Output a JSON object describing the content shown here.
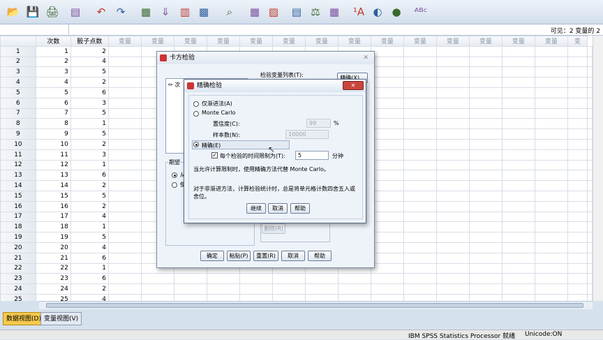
{
  "toolbar": {
    "icons": [
      "open-icon",
      "save-icon",
      "print-icon",
      "dialog-recall-icon",
      "undo-icon",
      "redo-icon",
      "goto-case-icon",
      "goto-variable-icon",
      "variables-icon",
      "run-descriptives-icon",
      "find-icon",
      "insert-cases-icon",
      "insert-variable-icon",
      "split-file-icon",
      "weight-cases-icon",
      "select-cases-icon",
      "value-labels-icon",
      "use-variable-sets-icon",
      "show-all-variables-icon",
      "spell-check-icon"
    ]
  },
  "visible_label": "可见：2 变量的 2",
  "grid": {
    "headers": [
      "次数",
      "骰子点数",
      "变量",
      "变量",
      "变量",
      "变量",
      "变量",
      "变量",
      "变量",
      "变量",
      "变量",
      "变量",
      "变量",
      "变量",
      "变量",
      "变量",
      "变"
    ],
    "rows": [
      [
        "1",
        "1",
        "2"
      ],
      [
        "2",
        "2",
        "4"
      ],
      [
        "3",
        "3",
        "5"
      ],
      [
        "4",
        "4",
        "2"
      ],
      [
        "5",
        "5",
        "6"
      ],
      [
        "6",
        "6",
        "3"
      ],
      [
        "7",
        "7",
        "5"
      ],
      [
        "8",
        "8",
        "1"
      ],
      [
        "9",
        "9",
        "5"
      ],
      [
        "10",
        "10",
        "2"
      ],
      [
        "11",
        "11",
        "3"
      ],
      [
        "12",
        "12",
        "1"
      ],
      [
        "13",
        "13",
        "6"
      ],
      [
        "14",
        "14",
        "2"
      ],
      [
        "15",
        "15",
        "5"
      ],
      [
        "16",
        "16",
        "2"
      ],
      [
        "17",
        "17",
        "4"
      ],
      [
        "18",
        "18",
        "1"
      ],
      [
        "19",
        "19",
        "5"
      ],
      [
        "20",
        "20",
        "4"
      ],
      [
        "21",
        "21",
        "6"
      ],
      [
        "22",
        "22",
        "1"
      ],
      [
        "23",
        "23",
        "6"
      ],
      [
        "24",
        "24",
        "2"
      ],
      [
        "25",
        "25",
        "4"
      ]
    ]
  },
  "tabs": {
    "data_view": "数据视图(D)",
    "variable_view": "变量视图(V)"
  },
  "status": {
    "processor": "IBM SPSS Statistics Processor 就绪",
    "unicode": "Unicode:ON"
  },
  "chisq_dialog": {
    "title": "卡方检验",
    "test_var_list": "检验变量列表(T):",
    "exact_button": "精确(X)...",
    "left_list_fragment": "次",
    "expected_group_fragment": "期望",
    "radio1_fragment": "从",
    "radio2_fragment": "使",
    "remove_button": "删除(R)",
    "ok": "确定",
    "paste": "粘贴(P)",
    "reset": "重置(R)",
    "cancel": "取消",
    "help": "帮助"
  },
  "exact_dialog": {
    "title": "精确检验",
    "asymptotic": "仅渐进法(A)",
    "monte_carlo": "Monte Carlo",
    "confidence_label": "置信度(C):",
    "confidence_value": "99",
    "percent": "%",
    "samples_label": "样本数(N):",
    "samples_value": "10000",
    "exact": "精确(E)",
    "time_limit_label": "每个检验的时间限制为(T):",
    "time_limit_value": "5",
    "minutes": "分钟",
    "note1": "当允许计算限制时，使用精确方法代替 Monte Carlo。",
    "note2": "对于非渐进方法，计算检验统计时，总是将单元格计数四舍五入或舍位。",
    "continue": "继续",
    "cancel": "取消",
    "help": "帮助"
  }
}
